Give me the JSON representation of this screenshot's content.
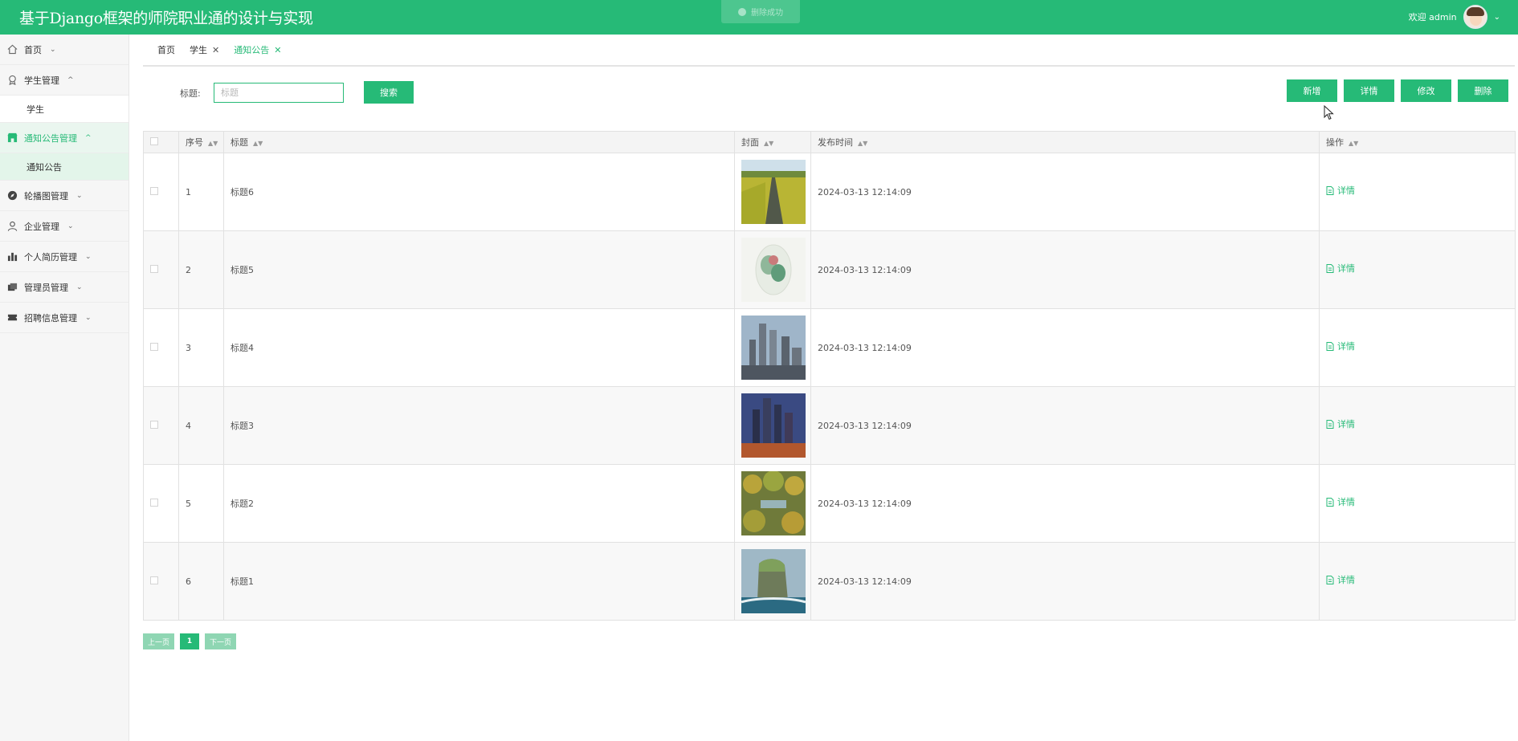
{
  "app": {
    "title": "基于Django框架的师院职业通的设计与实现"
  },
  "toast": {
    "text": "删除成功"
  },
  "user": {
    "welcome": "欢迎 admin"
  },
  "sidebar": {
    "items": [
      {
        "label": "首页"
      },
      {
        "label": "学生管理",
        "sub": [
          "学生"
        ]
      },
      {
        "label": "通知公告管理",
        "sub": [
          "通知公告"
        ]
      },
      {
        "label": "轮播图管理"
      },
      {
        "label": "企业管理"
      },
      {
        "label": "个人简历管理"
      },
      {
        "label": "管理员管理"
      },
      {
        "label": "招聘信息管理"
      }
    ]
  },
  "tabs": [
    {
      "label": "首页"
    },
    {
      "label": "学生"
    },
    {
      "label": "通知公告"
    }
  ],
  "search": {
    "label": "标题:",
    "placeholder": "标题",
    "button": "搜索"
  },
  "toolbar": {
    "add": "新增",
    "detail": "详情",
    "edit": "修改",
    "delete": "删除"
  },
  "table": {
    "headers": [
      "序号",
      "标题",
      "封面",
      "发布时间",
      "操作"
    ],
    "rows": [
      {
        "no": "1",
        "title": "标题6",
        "time": "2024-03-13 12:14:09",
        "op": "详情"
      },
      {
        "no": "2",
        "title": "标题5",
        "time": "2024-03-13 12:14:09",
        "op": "详情"
      },
      {
        "no": "3",
        "title": "标题4",
        "time": "2024-03-13 12:14:09",
        "op": "详情"
      },
      {
        "no": "4",
        "title": "标题3",
        "time": "2024-03-13 12:14:09",
        "op": "详情"
      },
      {
        "no": "5",
        "title": "标题2",
        "time": "2024-03-13 12:14:09",
        "op": "详情"
      },
      {
        "no": "6",
        "title": "标题1",
        "time": "2024-03-13 12:14:09",
        "op": "详情"
      }
    ]
  },
  "pager": {
    "prev": "上一页",
    "current": "1",
    "next": "下一页"
  },
  "colors": {
    "primary": "#26ba77",
    "sidebar_bg": "#f6f6f6"
  }
}
